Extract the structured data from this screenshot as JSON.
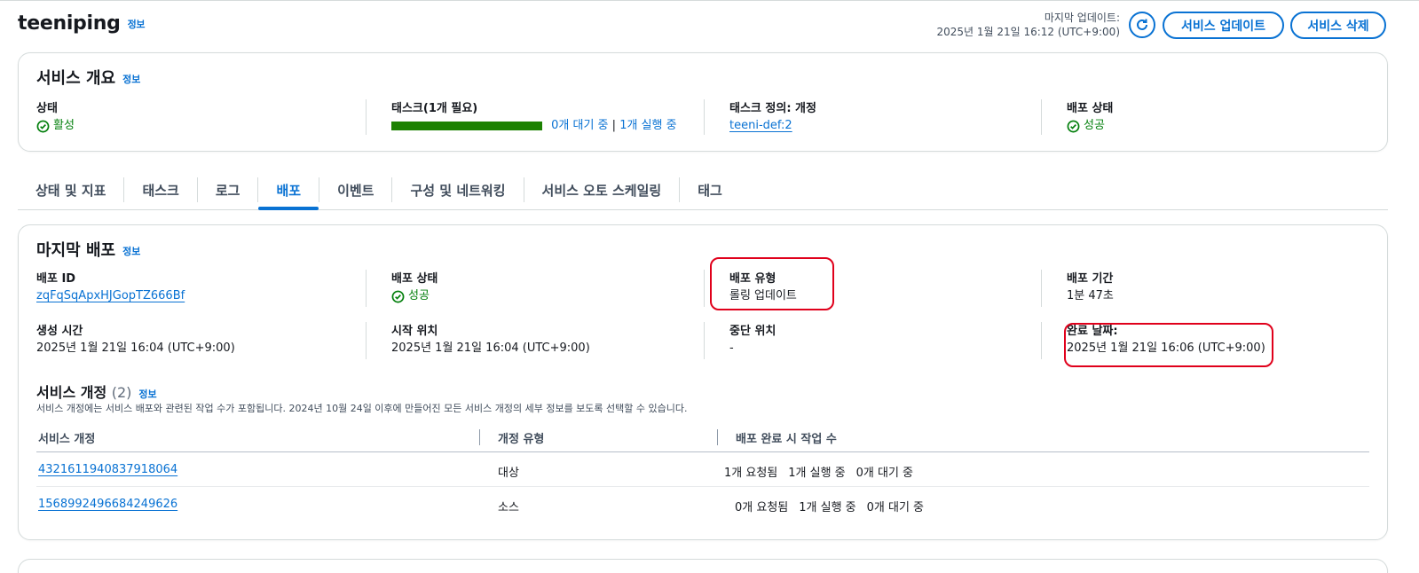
{
  "header": {
    "title": "teeniping",
    "info": "정보",
    "last_updated_label": "마지막 업데이트:",
    "last_updated_value": "2025년 1월 21일 16:12 (UTC+9:00)",
    "refresh_icon": "refresh-icon",
    "update_button": "서비스 업데이트",
    "delete_button": "서비스 삭제"
  },
  "overview": {
    "title": "서비스 개요",
    "info": "정보",
    "status_label": "상태",
    "status_value": "활성",
    "tasks_label": "태스크(1개 필요)",
    "tasks_progress": 1.0,
    "tasks_pending": "0개 대기 중",
    "tasks_sep": "|",
    "tasks_running": "1개 실행 중",
    "taskdef_label": "태스크 정의: 개정",
    "taskdef_value": "teeni-def:2",
    "deploy_status_label": "배포 상태",
    "deploy_status_value": "성공"
  },
  "tabs": [
    {
      "label": "상태 및 지표"
    },
    {
      "label": "태스크"
    },
    {
      "label": "로그"
    },
    {
      "label": "배포",
      "active": true
    },
    {
      "label": "이벤트"
    },
    {
      "label": "구성 및 네트워킹"
    },
    {
      "label": "서비스 오토 스케일링"
    },
    {
      "label": "태그"
    }
  ],
  "deployment": {
    "title": "마지막 배포",
    "info": "정보",
    "id_label": "배포 ID",
    "id_value": "zqFqSqApxHJGopTZ666Bf",
    "status_label": "배포 상태",
    "status_value": "성공",
    "type_label": "배포 유형",
    "type_value": "롤링 업데이트",
    "duration_label": "배포 기간",
    "duration_value": "1분 47초",
    "created_label": "생성 시간",
    "created_value": "2025년 1월 21일 16:04 (UTC+9:00)",
    "start_label": "시작 위치",
    "start_value": "2025년 1월 21일 16:04 (UTC+9:00)",
    "stop_label": "중단 위치",
    "stop_value": "-",
    "complete_label": "완료 날짜:",
    "complete_value": "2025년 1월 21일 16:06 (UTC+9:00)"
  },
  "revisions": {
    "title": "서비스 개정",
    "count": "(2)",
    "info": "정보",
    "description": "서비스 개정에는 서비스 배포와 관련된 작업 수가 포함됩니다. 2024년 10월 24일 이후에 만들어진 모든 서비스 개정의 세부 정보를 보도록 선택할 수 있습니다.",
    "columns": [
      "서비스 개정",
      "개정 유형",
      "배포 완료 시 작업 수"
    ],
    "rows": [
      {
        "id": "4321611940837918064",
        "type": "대상",
        "requested": "1개 요청됨",
        "running": "1개 실행 중",
        "pending": "0개 대기 중"
      },
      {
        "id": "1568992496684249626",
        "type": "소스",
        "requested": "0개 요청됨",
        "running": "1개 실행 중",
        "pending": "0개 대기 중"
      }
    ]
  },
  "colors": {
    "accent": "#0972d3",
    "success": "#037f0c",
    "highlight": "#e0001b"
  }
}
